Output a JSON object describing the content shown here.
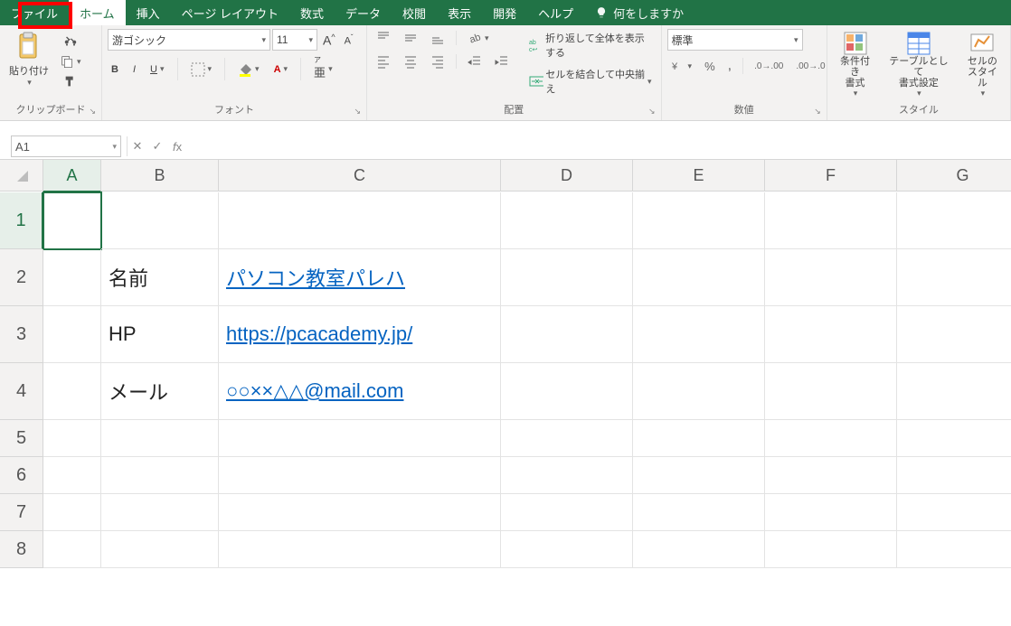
{
  "tabs": {
    "file": "ファイル",
    "home": "ホーム",
    "insert": "挿入",
    "layout": "ページ レイアウト",
    "formulas": "数式",
    "data": "データ",
    "review": "校閲",
    "view": "表示",
    "developer": "開発",
    "help": "ヘルプ",
    "tellme": "何をしますか"
  },
  "ribbon": {
    "clipboard": {
      "label": "クリップボード",
      "paste": "貼り付け"
    },
    "font": {
      "label": "フォント",
      "family": "游ゴシック",
      "size": "11",
      "bold": "B",
      "italic": "I",
      "underline": "U"
    },
    "align": {
      "label": "配置",
      "wrap": "折り返して全体を表示する",
      "merge": "セルを結合して中央揃え"
    },
    "number": {
      "label": "数値",
      "format": "標準"
    },
    "styles": {
      "label": "スタイル",
      "cond": "条件付き\n書式",
      "table": "テーブルとして\n書式設定",
      "cell": "セルの\nスタイル"
    }
  },
  "formulaBar": {
    "nameBox": "A1",
    "value": ""
  },
  "columns": [
    "A",
    "B",
    "C",
    "D",
    "E",
    "F",
    "G"
  ],
  "rows": [
    "1",
    "2",
    "3",
    "4",
    "5",
    "6",
    "7",
    "8"
  ],
  "cells": {
    "B2": "名前",
    "C2": "パソコン教室パレハ",
    "B3": "HP",
    "C3": "https://pcacademy.jp/",
    "B4": "メール",
    "C4": "○○××△△@mail.com"
  },
  "hyperlinks": [
    "C2",
    "C3",
    "C4"
  ],
  "selectedCell": "A1"
}
